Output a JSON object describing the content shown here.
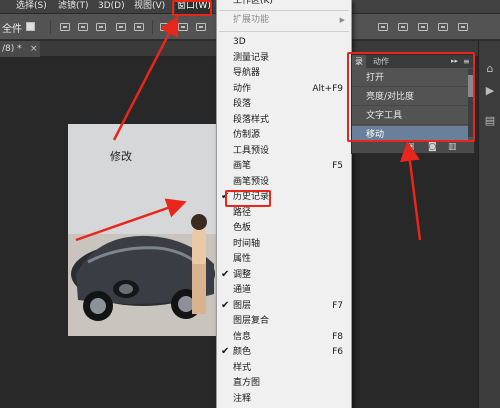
{
  "menubar": {
    "items": [
      "选择(S)",
      "滤镜(T)",
      "3D(D)",
      "视图(V)",
      "窗口(W)"
    ]
  },
  "optionsbar": {
    "label": "全件"
  },
  "tab": {
    "title": "/8) *",
    "close": "×"
  },
  "canvas": {
    "photo_text": "修改"
  },
  "window_menu": {
    "top_item": "工作区(K)",
    "extensions": "扩展功能",
    "items": [
      {
        "label": "3D",
        "shortcut": "",
        "checked": false
      },
      {
        "label": "测量记录",
        "shortcut": "",
        "checked": false
      },
      {
        "label": "导航器",
        "shortcut": "",
        "checked": false
      },
      {
        "label": "动作",
        "shortcut": "Alt+F9",
        "checked": false
      },
      {
        "label": "段落",
        "shortcut": "",
        "checked": false
      },
      {
        "label": "段落样式",
        "shortcut": "",
        "checked": false
      },
      {
        "label": "仿制源",
        "shortcut": "",
        "checked": false
      },
      {
        "label": "工具预设",
        "shortcut": "",
        "checked": false
      },
      {
        "label": "画笔",
        "shortcut": "F5",
        "checked": false
      },
      {
        "label": "画笔预设",
        "shortcut": "",
        "checked": false
      },
      {
        "label": "历史记录",
        "shortcut": "",
        "checked": true
      },
      {
        "label": "路径",
        "shortcut": "",
        "checked": false
      },
      {
        "label": "色板",
        "shortcut": "",
        "checked": false
      },
      {
        "label": "时间轴",
        "shortcut": "",
        "checked": false
      },
      {
        "label": "属性",
        "shortcut": "",
        "checked": false
      },
      {
        "label": "调整",
        "shortcut": "",
        "checked": true
      },
      {
        "label": "通道",
        "shortcut": "",
        "checked": false
      },
      {
        "label": "图层",
        "shortcut": "F7",
        "checked": true
      },
      {
        "label": "图层复合",
        "shortcut": "",
        "checked": false
      },
      {
        "label": "信息",
        "shortcut": "F8",
        "checked": false
      },
      {
        "label": "颜色",
        "shortcut": "F6",
        "checked": true
      },
      {
        "label": "样式",
        "shortcut": "",
        "checked": false
      },
      {
        "label": "直方图",
        "shortcut": "",
        "checked": false
      },
      {
        "label": "注释",
        "shortcut": "",
        "checked": false
      }
    ]
  },
  "history_panel": {
    "tabs": [
      "录",
      "动作"
    ],
    "rows": [
      {
        "label": "打开",
        "selected": false
      },
      {
        "label": "亮度/对比度",
        "selected": false
      },
      {
        "label": "文字工具",
        "selected": false
      },
      {
        "label": "移动",
        "selected": true
      }
    ]
  },
  "colors": {
    "annotation_red": "#e8261c",
    "menubar_bg": "#414141",
    "menu_bg": "#f0f0f0",
    "selection_blue": "#6a7f99"
  }
}
